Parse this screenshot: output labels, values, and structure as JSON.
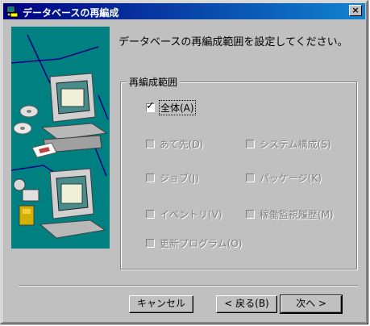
{
  "window": {
    "title": "データベースの再編成",
    "close_glyph": "×"
  },
  "instruction": "データベースの再編成範囲を設定してください。",
  "group": {
    "label": "再編成範囲",
    "options": [
      {
        "label": "全体(A)",
        "checked": true,
        "enabled": true
      },
      {
        "label": "あて先(D)",
        "checked": false,
        "enabled": false
      },
      {
        "label": "システム構成(S)",
        "checked": false,
        "enabled": false
      },
      {
        "label": "ジョブ(J)",
        "checked": false,
        "enabled": false
      },
      {
        "label": "パッケージ(K)",
        "checked": false,
        "enabled": false
      },
      {
        "label": "イベントリ(V)",
        "checked": false,
        "enabled": false
      },
      {
        "label": "稼働監視履歴(M)",
        "checked": false,
        "enabled": false
      },
      {
        "label": "更新プログラム(O)",
        "checked": false,
        "enabled": false
      }
    ]
  },
  "buttons": {
    "cancel": "キャンセル",
    "back": "< 戻る(B)",
    "next": "次へ >"
  },
  "colors": {
    "title_start": "#000080",
    "title_end": "#1084d0",
    "art_bg": "#008080",
    "face": "#c0c0c0"
  },
  "icons": {
    "title": "wizard-app-icon",
    "check": "checkmark-icon",
    "close": "close-icon"
  }
}
